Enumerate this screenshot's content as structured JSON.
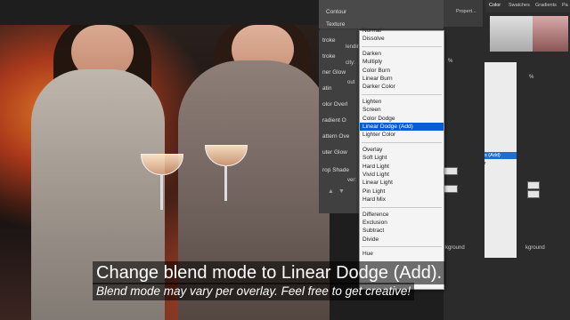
{
  "layer_style": {
    "header_items": [
      "Contour",
      "Texture"
    ],
    "items": [
      "troke",
      "troke",
      "ner Glow",
      "atin",
      "olor Overl",
      "radient O",
      "attern Ove",
      "uter Glow",
      "rop Shade"
    ],
    "fragments": [
      "lendir",
      "city:",
      "out",
      "ver:"
    ]
  },
  "blend_modes": {
    "groups": [
      [
        "Normal",
        "Dissolve"
      ],
      [
        "Darken",
        "Multiply",
        "Color Burn",
        "Linear Burn",
        "Darker Color"
      ],
      [
        "Lighten",
        "Screen",
        "Color Dodge",
        "Linear Dodge (Add)",
        "Lighter Color"
      ],
      [
        "Overlay",
        "Soft Light",
        "Hard Light",
        "Vivid Light",
        "Linear Light",
        "Pin Light",
        "Hard Mix"
      ],
      [
        "Difference",
        "Exclusion",
        "Subtract",
        "Divide"
      ],
      [
        "Hue"
      ]
    ],
    "selected": "Linear Dodge (Add)"
  },
  "right_panel": {
    "tabs": [
      "Propert...",
      "Color",
      "Swatches",
      "Gradients",
      "Pa"
    ],
    "list_fragments": [
      "s (Add)",
      "r"
    ],
    "bottom_fragments": [
      "kground",
      "kground"
    ],
    "percent": "%"
  },
  "captions": {
    "main": "Change blend mode to Linear Dodge (Add).",
    "sub": "Blend mode may vary per overlay. Feel free to get creative!"
  },
  "colors": {
    "selection": "#0a5bd6",
    "caption_bg": "rgba(0,0,0,0.55)"
  }
}
